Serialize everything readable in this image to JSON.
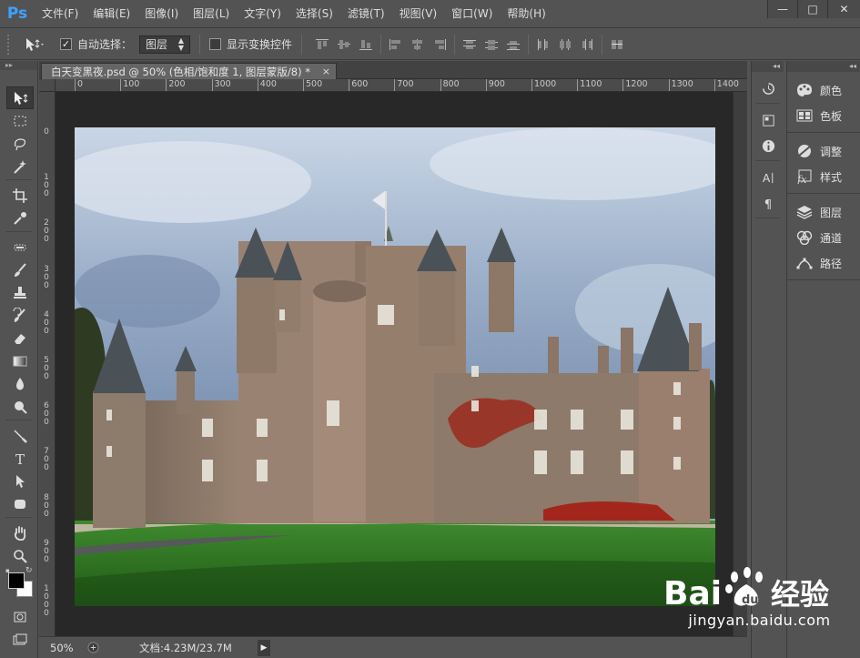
{
  "app": {
    "logo": "Ps",
    "menu": [
      "文件(F)",
      "编辑(E)",
      "图像(I)",
      "图层(L)",
      "文字(Y)",
      "选择(S)",
      "滤镜(T)",
      "视图(V)",
      "窗口(W)",
      "帮助(H)"
    ],
    "window_controls": {
      "minimize": "—",
      "maximize": "□",
      "close": "✕"
    }
  },
  "options_bar": {
    "auto_select_label": "自动选择：",
    "auto_select_checked": true,
    "auto_select_target": "图层",
    "show_transform_label": "显示变换控件",
    "show_transform_checked": false
  },
  "document": {
    "tab_title": "白天变黑夜.psd @ 50% (色相/饱和度 1, 图层蒙版/8) *",
    "tab_close": "×",
    "ruler_h_labels": [
      "0",
      "100",
      "200",
      "300",
      "400",
      "500",
      "600",
      "700",
      "800",
      "900",
      "1000",
      "1100",
      "1200",
      "1300",
      "1400"
    ],
    "ruler_v_labels": [
      "0",
      "100",
      "200",
      "300",
      "400",
      "500",
      "600",
      "700",
      "800",
      "900",
      "1000"
    ]
  },
  "status_bar": {
    "zoom": "50%",
    "doc_size": "文档:4.23M/23.7M"
  },
  "panels": {
    "groups": [
      [
        {
          "icon": "color-icon",
          "label": "颜色"
        },
        {
          "icon": "swatches-icon",
          "label": "色板"
        }
      ],
      [
        {
          "icon": "adjustments-icon",
          "label": "调整"
        },
        {
          "icon": "styles-icon",
          "label": "样式"
        }
      ],
      [
        {
          "icon": "layers-icon",
          "label": "图层"
        },
        {
          "icon": "channels-icon",
          "label": "通道"
        },
        {
          "icon": "paths-icon",
          "label": "路径"
        }
      ]
    ]
  },
  "watermark": {
    "brand": "Bai 经验",
    "url": "jingyan.baidu.com"
  }
}
